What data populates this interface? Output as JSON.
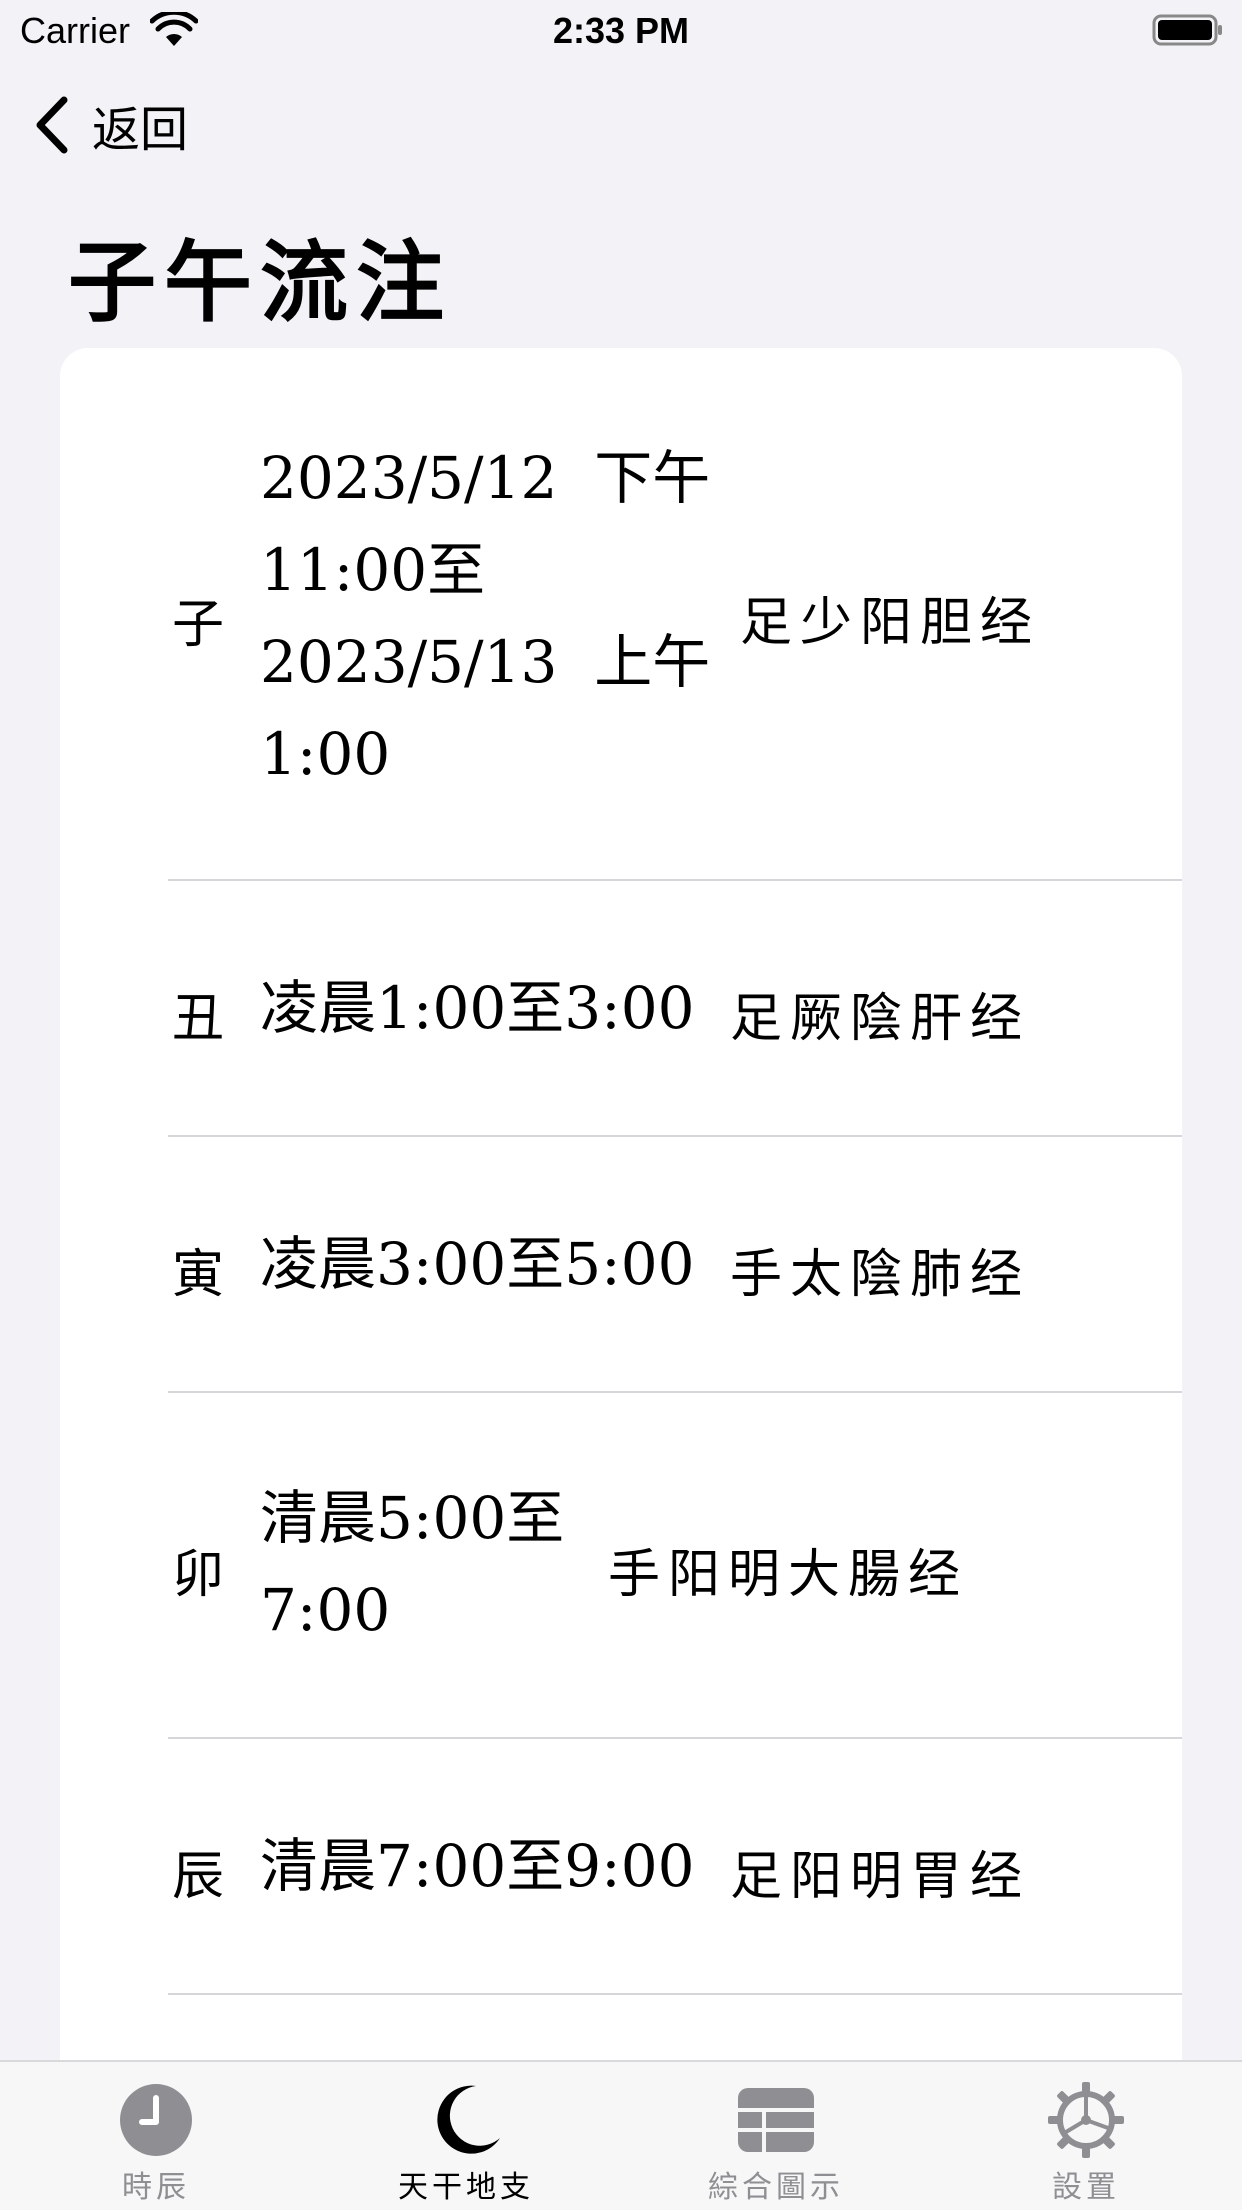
{
  "status_bar": {
    "carrier": "Carrier",
    "time": "2:33 PM"
  },
  "nav": {
    "back_label": "返回",
    "title": "子午流注"
  },
  "rows": [
    {
      "branch": "子",
      "time": "2023/5/12  下午\n11:00至\n2023/5/13  上午\n1:00",
      "meridian": "足少阳胆经"
    },
    {
      "branch": "丑",
      "time": "凌晨1:00至3:00",
      "meridian": "足厥陰肝经"
    },
    {
      "branch": "寅",
      "time": "凌晨3:00至5:00",
      "meridian": "手太陰肺经"
    },
    {
      "branch": "卯",
      "time": "清晨5:00至\n7:00",
      "meridian": "手阳明大腸经"
    },
    {
      "branch": "辰",
      "time": "清晨7:00至9:00",
      "meridian": "足阳明胃经"
    }
  ],
  "tabs": [
    {
      "label": "時辰",
      "icon": "clock-icon",
      "active": false
    },
    {
      "label": "天干地支",
      "icon": "moon-icon",
      "active": true
    },
    {
      "label": "綜合圖示",
      "icon": "grid-icon",
      "active": false
    },
    {
      "label": "設置",
      "icon": "gear-icon",
      "active": false
    }
  ],
  "colors": {
    "background": "#f2f2f7",
    "card": "#ffffff",
    "inactive_tab": "#8e8e93",
    "active_tab": "#000000"
  }
}
